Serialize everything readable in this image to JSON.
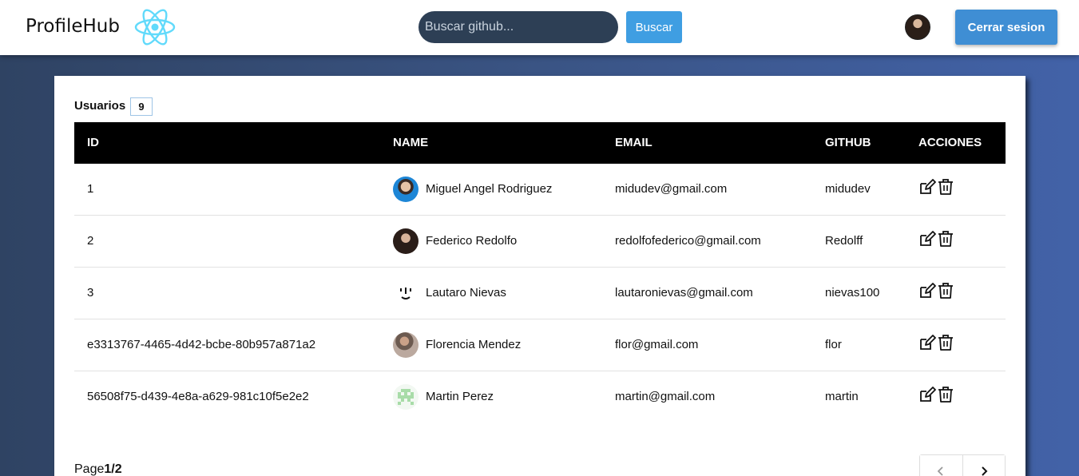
{
  "navbar": {
    "brand": "ProfileHub",
    "search_placeholder": "Buscar github...",
    "search_button": "Buscar",
    "logout_button": "Cerrar sesion"
  },
  "summary": {
    "label": "Usuarios",
    "count": "9"
  },
  "table": {
    "columns": [
      "ID",
      "NAME",
      "EMAIL",
      "GITHUB",
      "ACCIONES"
    ],
    "rows": [
      {
        "id": "1",
        "name": "Miguel Angel Rodriguez",
        "email": "midudev@gmail.com",
        "github": "midudev",
        "avatar": "photo-blue-bg"
      },
      {
        "id": "2",
        "name": "Federico Redolfo",
        "email": "redolfofederico@gmail.com",
        "github": "Redolff",
        "avatar": "photo-dark-bg"
      },
      {
        "id": "3",
        "name": "Lautaro Nievas",
        "email": "lautaronievas@gmail.com",
        "github": "nievas100",
        "avatar": "emoji-face"
      },
      {
        "id": "e3313767-4465-4d42-bcbe-80b957a871a2",
        "name": "Florencia Mendez",
        "email": "flor@gmail.com",
        "github": "flor",
        "avatar": "photo-camera"
      },
      {
        "id": "56508f75-d439-4e8a-a629-981c10f5e2e2",
        "name": "Martin Perez",
        "email": "martin@gmail.com",
        "github": "martin",
        "avatar": "identicon-green"
      }
    ]
  },
  "pagination": {
    "prefix": "Page",
    "current": "1",
    "separator": "/",
    "total": "2"
  },
  "icons": {
    "edit": "edit-icon",
    "delete": "trash-icon",
    "prev": "chevron-left-icon",
    "next": "chevron-right-icon",
    "logo": "react-logo-icon"
  },
  "colors": {
    "search_bg": "#2d3f55",
    "search_button": "#3f9ee2",
    "logout_button": "#3f8ed4",
    "table_header": "#000000",
    "react_logo": "#61dafb"
  }
}
